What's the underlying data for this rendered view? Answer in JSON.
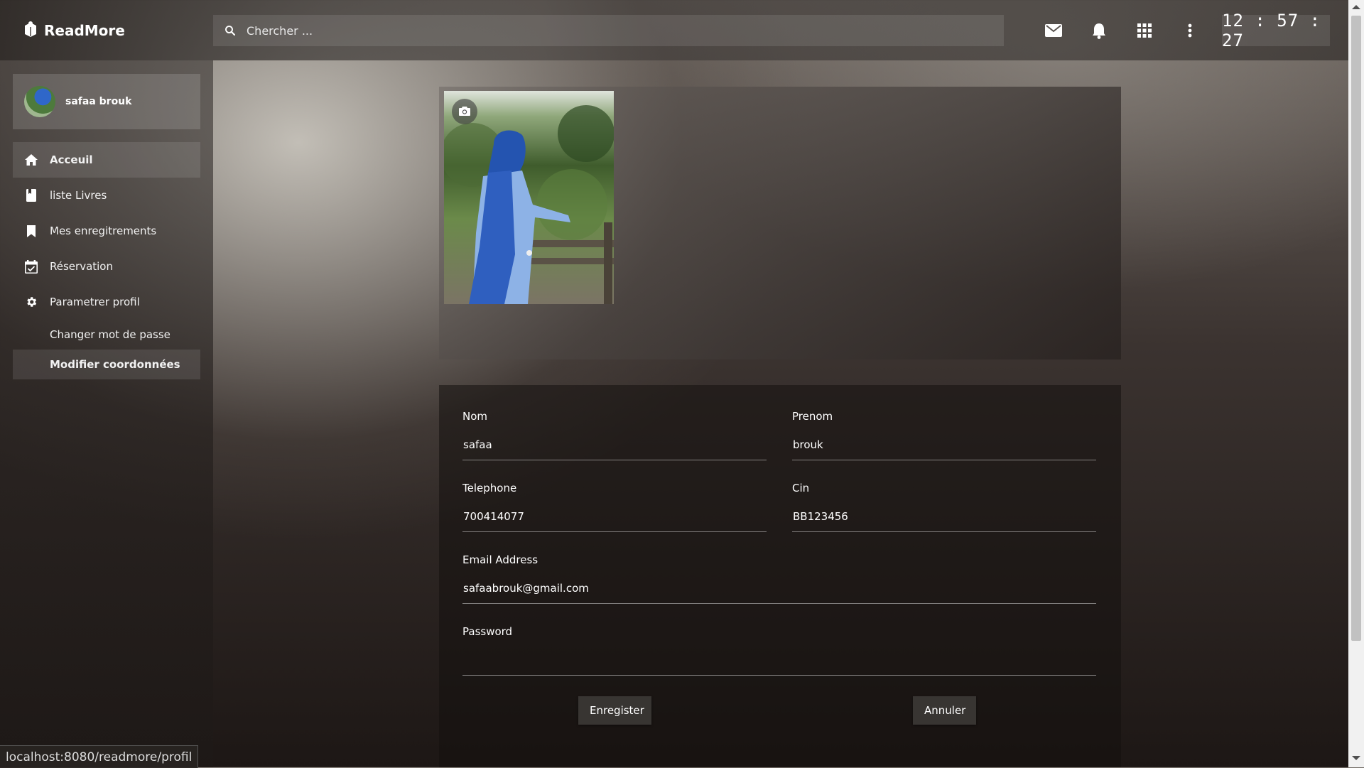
{
  "app": {
    "name": "ReadMore"
  },
  "search": {
    "placeholder": "Chercher ..."
  },
  "topbar": {
    "icons": [
      "mail-icon",
      "bell-icon",
      "apps-grid-icon",
      "more-vert-icon"
    ],
    "clock": "12 : 57 : 27"
  },
  "user": {
    "name": "safaa brouk"
  },
  "sidebar": {
    "items": [
      {
        "label": "Acceuil",
        "icon": "home-icon"
      },
      {
        "label": "liste Livres",
        "icon": "book-icon"
      },
      {
        "label": "Mes enregitrements",
        "icon": "bookmark-icon"
      },
      {
        "label": "Réservation",
        "icon": "calendar-check-icon"
      },
      {
        "label": "Parametrer profil",
        "icon": "gear-icon"
      }
    ],
    "sub_items": [
      {
        "label": "Changer mot de passe"
      },
      {
        "label": "Modifier coordonnées"
      }
    ]
  },
  "form": {
    "nom": {
      "label": "Nom",
      "value": "safaa"
    },
    "prenom": {
      "label": "Prenom",
      "value": "brouk"
    },
    "telephone": {
      "label": "Telephone",
      "value": "700414077"
    },
    "cin": {
      "label": "Cin",
      "value": "BB123456"
    },
    "email": {
      "label": "Email Address",
      "value": "safaabrouk@gmail.com"
    },
    "password": {
      "label": "Password",
      "value": ""
    },
    "save_label": "Enregister",
    "cancel_label": "Annuler"
  },
  "status_bar": {
    "url": "localhost:8080/readmore/profil"
  },
  "colors": {
    "accent": "#ffffff",
    "photo_hijab": "#2f5fbf"
  }
}
